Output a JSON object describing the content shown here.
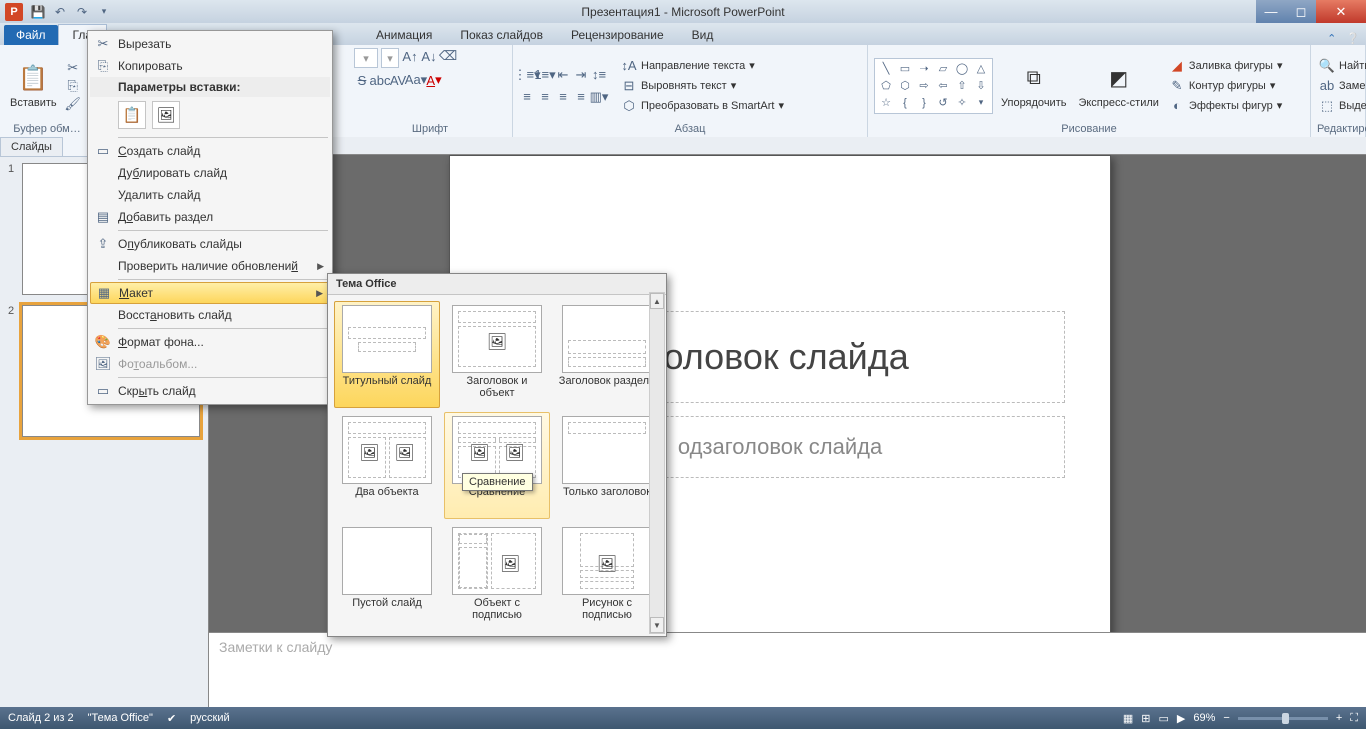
{
  "title": "Презентация1 - Microsoft PowerPoint",
  "tabs": {
    "file": "Файл",
    "home": "Гла",
    "insert": "",
    "design": "",
    "transitions": "",
    "anim": "Анимация",
    "slideshow": "Показ слайдов",
    "review": "Рецензирование",
    "view": "Вид"
  },
  "ribbon": {
    "clipboard": {
      "paste": "Вставить",
      "label": "Буфер обм…"
    },
    "font": {
      "label": "Шрифт"
    },
    "paragraph": {
      "label": "Абзац",
      "textdir": "Направление текста",
      "align": "Выровнять текст",
      "smartart": "Преобразовать в SmartArt"
    },
    "drawing": {
      "label": "Рисование",
      "arrange": "Упорядочить",
      "styles": "Экспресс-стили",
      "fill": "Заливка фигуры",
      "outline": "Контур фигуры",
      "effects": "Эффекты фигур"
    },
    "editing": {
      "label": "Редактирование",
      "find": "Найти",
      "replace": "Заменить",
      "select": "Выделить"
    }
  },
  "panel": {
    "tab1": "Слайды",
    "tab2": ""
  },
  "slide": {
    "title": "головок слайда",
    "sub": "одзаголовок слайда",
    "notes": "Заметки к слайду"
  },
  "ctx": {
    "cut": "Вырезать",
    "copy": "Копировать",
    "pasteopts": "Параметры вставки:",
    "new": "Создать слайд",
    "dup": "Дублировать слайд",
    "del": "Удалить слайд",
    "section": "Добавить раздел",
    "publish": "Опубликовать слайды",
    "update": "Проверить наличие обновлений",
    "layout": "Макет",
    "reset": "Восстановить слайд",
    "bg": "Формат фона...",
    "album": "Фотоальбом...",
    "hide": "Скрыть слайд"
  },
  "flyout": {
    "hdr": "Тема Office",
    "items": [
      "Титульный слайд",
      "Заголовок и объект",
      "Заголовок раздела",
      "Два объекта",
      "Сравнение",
      "Только заголовок",
      "Пустой слайд",
      "Объект с подписью",
      "Рисунок с подписью"
    ],
    "tooltip": "Сравнение"
  },
  "status": {
    "pos": "Слайд 2 из 2",
    "theme": "\"Тема Office\"",
    "lang": "русский",
    "zoom": "69%"
  }
}
